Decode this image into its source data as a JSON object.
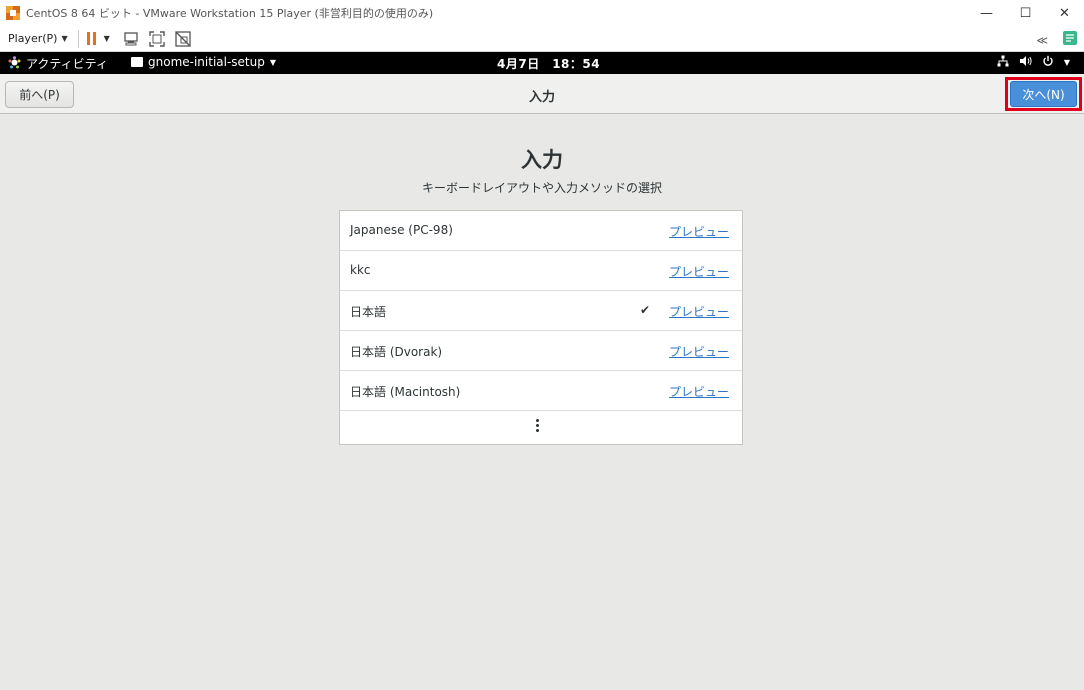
{
  "window": {
    "title": "CentOS 8 64 ビット - VMware Workstation 15 Player (非営利目的の使用のみ)",
    "minimize_glyph": "—",
    "maximize_glyph": "☐",
    "close_glyph": "✕"
  },
  "toolbar": {
    "player_menu": "Player(P)",
    "icons": [
      "pause-icon",
      "send-ctrl-alt-del-icon",
      "fullscreen-icon",
      "unity-icon",
      "back-arrows-icon",
      "notes-icon"
    ]
  },
  "gnome_bar": {
    "activities": "アクティビティ",
    "app_menu": "gnome-initial-setup",
    "clock": "4月7日　18：54"
  },
  "header": {
    "prev_button": "前へ(P)",
    "title": "入力",
    "next_button": "次へ(N)"
  },
  "page": {
    "title": "入力",
    "subtitle": "キーボードレイアウトや入力メソッドの選択",
    "layouts": [
      {
        "name": "Japanese (PC-98)",
        "selected": false,
        "preview": "プレビュー"
      },
      {
        "name": "kkc",
        "selected": false,
        "preview": "プレビュー"
      },
      {
        "name": "日本語",
        "selected": true,
        "preview": "プレビュー"
      },
      {
        "name": "日本語 (Dvorak)",
        "selected": false,
        "preview": "プレビュー"
      },
      {
        "name": "日本語 (Macintosh)",
        "selected": false,
        "preview": "プレビュー"
      }
    ],
    "check_glyph": "✔"
  },
  "colors": {
    "accent": "#4a90d9",
    "highlight_outline": "#e0001b",
    "link": "#2a76c6",
    "pause": "#e8701a"
  }
}
